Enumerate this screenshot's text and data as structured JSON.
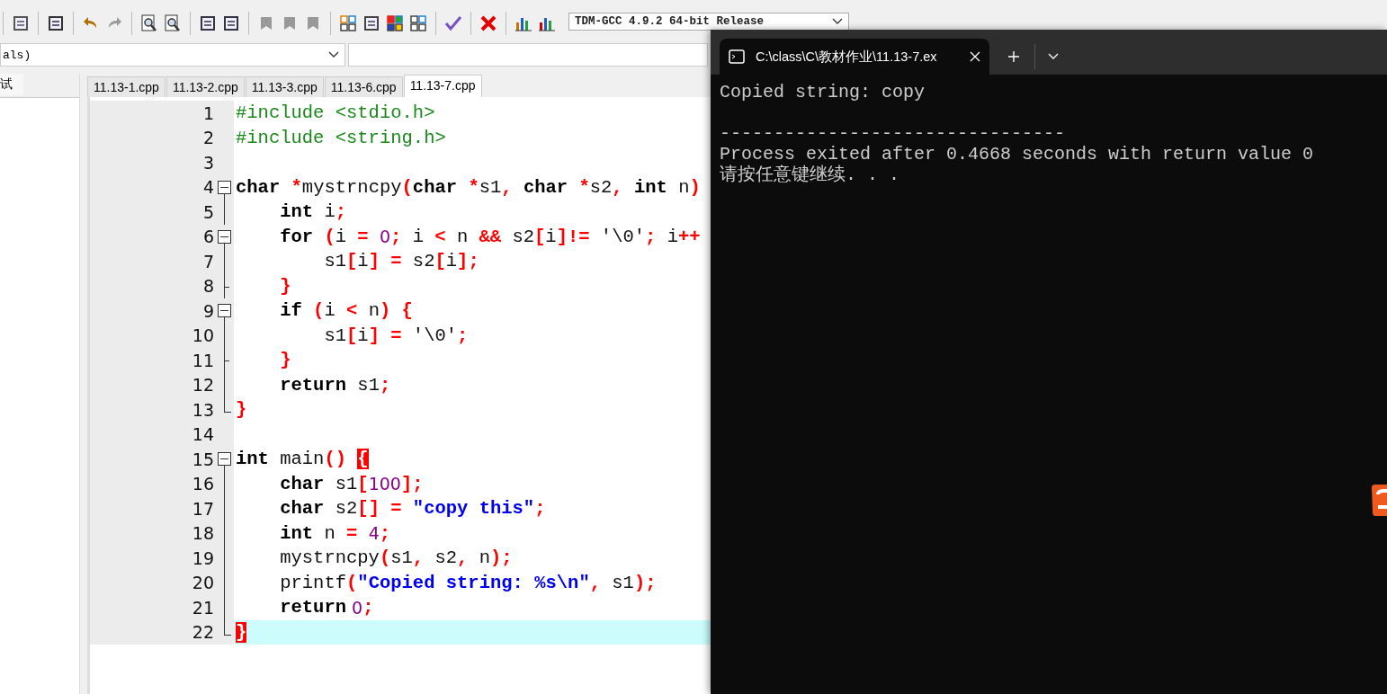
{
  "toolbar": {
    "compiler": "TDM-GCC 4.9.2 64-bit Release"
  },
  "class_box": {
    "value": "als)"
  },
  "left_panel": {
    "tab": "试"
  },
  "tabs": [
    {
      "label": "11.13-1.cpp",
      "selected": false
    },
    {
      "label": "11.13-2.cpp",
      "selected": false
    },
    {
      "label": "11.13-3.cpp",
      "selected": false
    },
    {
      "label": "11.13-6.cpp",
      "selected": false
    },
    {
      "label": "11.13-7.cpp",
      "selected": true
    }
  ],
  "editor": {
    "lines": [
      {
        "number": "1",
        "kind": "plain",
        "current": false,
        "tokens": [
          {
            "kind": "pp",
            "text": "#include <stdio.h>"
          }
        ]
      },
      {
        "number": "2",
        "kind": "plain",
        "current": false,
        "tokens": [
          {
            "kind": "pp",
            "text": "#include <string.h>"
          }
        ]
      },
      {
        "number": "3",
        "kind": "plain",
        "current": false
      },
      {
        "number": "4",
        "kind": "fold_start",
        "current": false,
        "tokens": [
          {
            "kind": "kw",
            "text": "char"
          },
          {
            "kind": "sym",
            "text": " *"
          },
          {
            "kind": "id",
            "text": "mystrncpy"
          },
          {
            "kind": "sym",
            "text": "("
          },
          {
            "kind": "kw",
            "text": "char"
          },
          {
            "kind": "sym",
            "text": " *"
          },
          {
            "kind": "id",
            "text": "s1"
          },
          {
            "kind": "sym",
            "text": ", "
          },
          {
            "kind": "kw",
            "text": "char"
          },
          {
            "kind": "sym",
            "text": " *"
          },
          {
            "kind": "id",
            "text": "s2"
          },
          {
            "kind": "sym",
            "text": ", "
          },
          {
            "kind": "kw",
            "text": "int"
          },
          {
            "kind": "id",
            "text": " n"
          },
          {
            "kind": "sym",
            "text": ")"
          }
        ]
      },
      {
        "number": "5",
        "kind": "fold_line",
        "current": false,
        "tokens": [
          {
            "kind": "kw",
            "text": "    int"
          },
          {
            "kind": "id",
            "text": " i"
          },
          {
            "kind": "sym",
            "text": ";"
          }
        ]
      },
      {
        "number": "6",
        "kind": "fold_start",
        "current": false,
        "tokens": [
          {
            "kind": "kw",
            "text": "    for"
          },
          {
            "kind": "sym",
            "text": " ("
          },
          {
            "kind": "id",
            "text": "i "
          },
          {
            "kind": "sym",
            "text": "= "
          },
          {
            "kind": "num",
            "text": "0"
          },
          {
            "kind": "sym",
            "text": ";"
          },
          {
            "kind": "id",
            "text": " i "
          },
          {
            "kind": "sym",
            "text": "<"
          },
          {
            "kind": "id",
            "text": " n "
          },
          {
            "kind": "sym",
            "text": "&&"
          },
          {
            "kind": "id",
            "text": " s2"
          },
          {
            "kind": "sym",
            "text": "["
          },
          {
            "kind": "id",
            "text": "i"
          },
          {
            "kind": "sym",
            "text": "]!="
          },
          {
            "kind": "id",
            "text": " '\\0'"
          },
          {
            "kind": "sym",
            "text": ";"
          },
          {
            "kind": "id",
            "text": " i"
          },
          {
            "kind": "sym",
            "text": "++"
          }
        ]
      },
      {
        "number": "7",
        "kind": "fold_line",
        "current": false,
        "tokens": [
          {
            "kind": "id",
            "text": "        s1"
          },
          {
            "kind": "sym",
            "text": "["
          },
          {
            "kind": "id",
            "text": "i"
          },
          {
            "kind": "sym",
            "text": "] ="
          },
          {
            "kind": "id",
            "text": " s2"
          },
          {
            "kind": "sym",
            "text": "["
          },
          {
            "kind": "id",
            "text": "i"
          },
          {
            "kind": "sym",
            "text": "];"
          }
        ]
      },
      {
        "number": "8",
        "kind": "fold_tick",
        "current": false,
        "tokens": [
          {
            "kind": "sym",
            "text": "    }"
          }
        ]
      },
      {
        "number": "9",
        "kind": "fold_start",
        "current": false,
        "tokens": [
          {
            "kind": "kw",
            "text": "    if"
          },
          {
            "kind": "sym",
            "text": " ("
          },
          {
            "kind": "id",
            "text": "i "
          },
          {
            "kind": "sym",
            "text": "<"
          },
          {
            "kind": "id",
            "text": " n"
          },
          {
            "kind": "sym",
            "text": ") {"
          }
        ]
      },
      {
        "number": "10",
        "kind": "fold_line",
        "current": false,
        "tokens": [
          {
            "kind": "id",
            "text": "        s1"
          },
          {
            "kind": "sym",
            "text": "["
          },
          {
            "kind": "id",
            "text": "i"
          },
          {
            "kind": "sym",
            "text": "] ="
          },
          {
            "kind": "id",
            "text": " '\\0'"
          },
          {
            "kind": "sym",
            "text": ";"
          }
        ]
      },
      {
        "number": "11",
        "kind": "fold_tick",
        "current": false,
        "tokens": [
          {
            "kind": "sym",
            "text": "    }"
          }
        ]
      },
      {
        "number": "12",
        "kind": "fold_line",
        "current": false,
        "tokens": [
          {
            "kind": "kw",
            "text": "    return"
          },
          {
            "kind": "id",
            "text": " s1"
          },
          {
            "kind": "sym",
            "text": ";"
          }
        ]
      },
      {
        "number": "13",
        "kind": "fold_end",
        "current": false,
        "tokens": [
          {
            "kind": "sym",
            "text": "}"
          }
        ]
      },
      {
        "number": "14",
        "kind": "plain",
        "current": false
      },
      {
        "number": "15",
        "kind": "fold_start",
        "current": false,
        "tokens": [
          {
            "kind": "kw",
            "text": "int"
          },
          {
            "kind": "id",
            "text": " main"
          },
          {
            "kind": "sym",
            "text": "() "
          },
          {
            "kind": "match",
            "text": "{"
          }
        ]
      },
      {
        "number": "16",
        "kind": "fold_line",
        "current": false,
        "tokens": [
          {
            "kind": "kw",
            "text": "    char"
          },
          {
            "kind": "id",
            "text": " s1"
          },
          {
            "kind": "sym",
            "text": "["
          },
          {
            "kind": "num",
            "text": "100"
          },
          {
            "kind": "sym",
            "text": "];"
          }
        ]
      },
      {
        "number": "17",
        "kind": "fold_line",
        "current": false,
        "tokens": [
          {
            "kind": "kw",
            "text": "    char"
          },
          {
            "kind": "id",
            "text": " s2"
          },
          {
            "kind": "sym",
            "text": "[] = "
          },
          {
            "kind": "str",
            "text": "\"copy this\""
          },
          {
            "kind": "sym",
            "text": ";"
          }
        ]
      },
      {
        "number": "18",
        "kind": "fold_line",
        "current": false,
        "tokens": [
          {
            "kind": "kw",
            "text": "    int"
          },
          {
            "kind": "id",
            "text": " n "
          },
          {
            "kind": "sym",
            "text": "= "
          },
          {
            "kind": "num",
            "text": "4"
          },
          {
            "kind": "sym",
            "text": ";"
          }
        ]
      },
      {
        "number": "19",
        "kind": "fold_line",
        "current": false,
        "tokens": [
          {
            "kind": "id",
            "text": "    mystrncpy"
          },
          {
            "kind": "sym",
            "text": "("
          },
          {
            "kind": "id",
            "text": "s1"
          },
          {
            "kind": "sym",
            "text": ","
          },
          {
            "kind": "id",
            "text": " s2"
          },
          {
            "kind": "sym",
            "text": ","
          },
          {
            "kind": "id",
            "text": " n"
          },
          {
            "kind": "sym",
            "text": ");"
          }
        ]
      },
      {
        "number": "20",
        "kind": "fold_line",
        "current": false,
        "tokens": [
          {
            "kind": "id",
            "text": "    printf"
          },
          {
            "kind": "sym",
            "text": "("
          },
          {
            "kind": "str",
            "text": "\"Copied string: %s\\n\""
          },
          {
            "kind": "sym",
            "text": ","
          },
          {
            "kind": "id",
            "text": " s1"
          },
          {
            "kind": "sym",
            "text": ");"
          }
        ]
      },
      {
        "number": "21",
        "kind": "fold_line",
        "current": false,
        "tokens": [
          {
            "kind": "kw",
            "text": "    return"
          },
          {
            "kind": "num",
            "text": " 0"
          },
          {
            "kind": "sym",
            "text": ";"
          }
        ]
      },
      {
        "number": "22",
        "kind": "fold_end",
        "current": true,
        "tokens": [
          {
            "kind": "match",
            "text": "}"
          }
        ]
      }
    ]
  },
  "terminal": {
    "tab_title": "C:\\class\\C\\教材作业\\11.13-7.ex",
    "lines": [
      "Copied string: copy",
      "--------------------------------",
      "Process exited after 0.4668 seconds with return value 0",
      "请按任意键继续. . ."
    ]
  }
}
